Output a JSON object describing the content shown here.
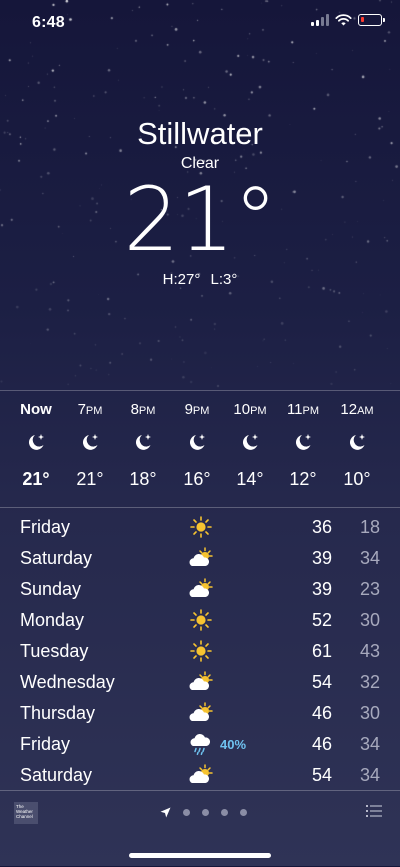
{
  "status": {
    "time": "6:48"
  },
  "location": {
    "city": "Stillwater",
    "condition": "Clear",
    "temperature": "21°",
    "high": "H:27°",
    "low": "L:3°"
  },
  "hourly": [
    {
      "label": "Now",
      "suffix": "",
      "temp": "21°",
      "icon": "moon-stars-icon",
      "bold": true
    },
    {
      "label": "7",
      "suffix": "PM",
      "temp": "21°",
      "icon": "moon-stars-icon"
    },
    {
      "label": "8",
      "suffix": "PM",
      "temp": "18°",
      "icon": "moon-stars-icon"
    },
    {
      "label": "9",
      "suffix": "PM",
      "temp": "16°",
      "icon": "moon-stars-icon"
    },
    {
      "label": "10",
      "suffix": "PM",
      "temp": "14°",
      "icon": "moon-stars-icon"
    },
    {
      "label": "11",
      "suffix": "PM",
      "temp": "12°",
      "icon": "moon-stars-icon"
    },
    {
      "label": "12",
      "suffix": "AM",
      "temp": "10°",
      "icon": "moon-stars-icon"
    }
  ],
  "daily": [
    {
      "day": "Friday",
      "icon": "sun-icon",
      "precip": "",
      "high": "36",
      "low": "18"
    },
    {
      "day": "Saturday",
      "icon": "partly-cloudy-icon",
      "precip": "",
      "high": "39",
      "low": "34"
    },
    {
      "day": "Sunday",
      "icon": "partly-cloudy-icon",
      "precip": "",
      "high": "39",
      "low": "23"
    },
    {
      "day": "Monday",
      "icon": "sun-icon",
      "precip": "",
      "high": "52",
      "low": "30"
    },
    {
      "day": "Tuesday",
      "icon": "sun-icon",
      "precip": "",
      "high": "61",
      "low": "43"
    },
    {
      "day": "Wednesday",
      "icon": "partly-cloudy-icon",
      "precip": "",
      "high": "54",
      "low": "32"
    },
    {
      "day": "Thursday",
      "icon": "partly-cloudy-icon",
      "precip": "",
      "high": "46",
      "low": "30"
    },
    {
      "day": "Friday",
      "icon": "cloud-rain-icon",
      "precip": "40%",
      "high": "46",
      "low": "34"
    },
    {
      "day": "Saturday",
      "icon": "partly-cloudy-icon",
      "precip": "",
      "high": "54",
      "low": "34"
    }
  ],
  "footer": {
    "logo_text": "The Weather Channel",
    "page_dots": 4
  },
  "colors": {
    "precip": "#6fc3f0",
    "sun": "#f6c330",
    "battery_low": "#ff3b30"
  }
}
